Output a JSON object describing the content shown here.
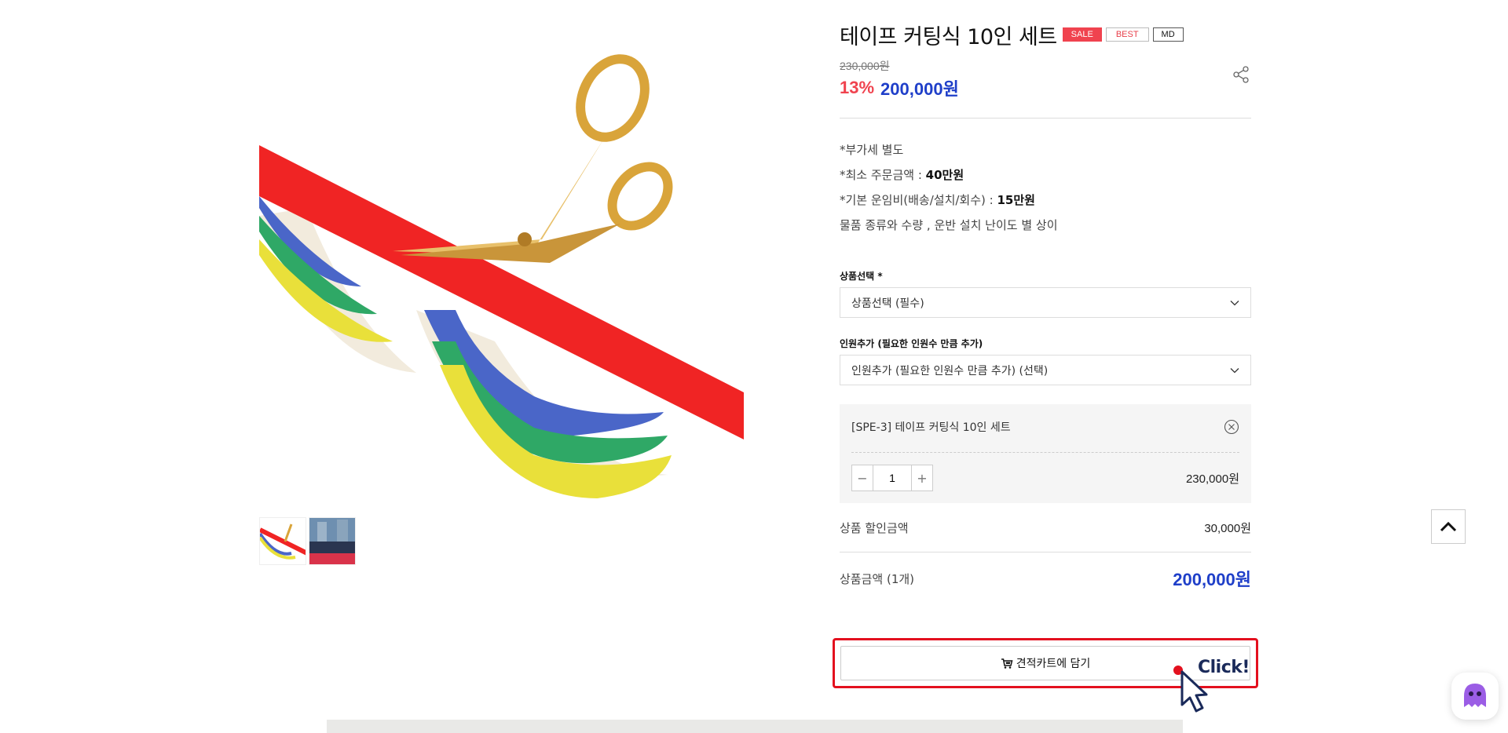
{
  "product": {
    "title": "테이프 커팅식 10인 세트",
    "badges": {
      "sale": "SALE",
      "best": "BEST",
      "md": "MD"
    },
    "price_original": "230,000원",
    "discount_rate": "13%",
    "price_sale": "200,000원"
  },
  "description": {
    "line1": "*부가세 별도",
    "line2_prefix": "*최소 주문금액 : ",
    "line2_value": "40만원",
    "line3_prefix": "*기본 운임비(배송/설치/회수) : ",
    "line3_value": "15만원",
    "line4": "물품 종류와 수량 , 운반 설치 난이도 별 상이"
  },
  "options": {
    "product_select_label": "상품선택 *",
    "product_select_value": "상품선택 (필수)",
    "people_add_label": "인원추가 (필요한 인원수 만큼 추가)",
    "people_add_value": "인원추가 (필요한 인원수 만큼 추가) (선택)"
  },
  "selected_option": {
    "name": "[SPE-3] 테이프 커팅식 10인 세트",
    "quantity": "1",
    "price": "230,000원"
  },
  "summary": {
    "discount_label": "상품 할인금액",
    "discount_value": "30,000원",
    "total_label": "상품금액 (1개)",
    "total_value": "200,000원"
  },
  "actions": {
    "cart_button": "견적카트에 담기",
    "click_label": "Click!"
  },
  "colors": {
    "sale_red": "#f0434f",
    "price_blue": "#1f3fc9",
    "highlight_red": "#e3101e"
  },
  "icons": [
    "share-icon",
    "chevron-down-icon",
    "close-circle-icon",
    "minus-icon",
    "plus-icon",
    "cart-icon",
    "arrow-up-icon",
    "chatbot-icon",
    "pointer-cursor-icon"
  ]
}
